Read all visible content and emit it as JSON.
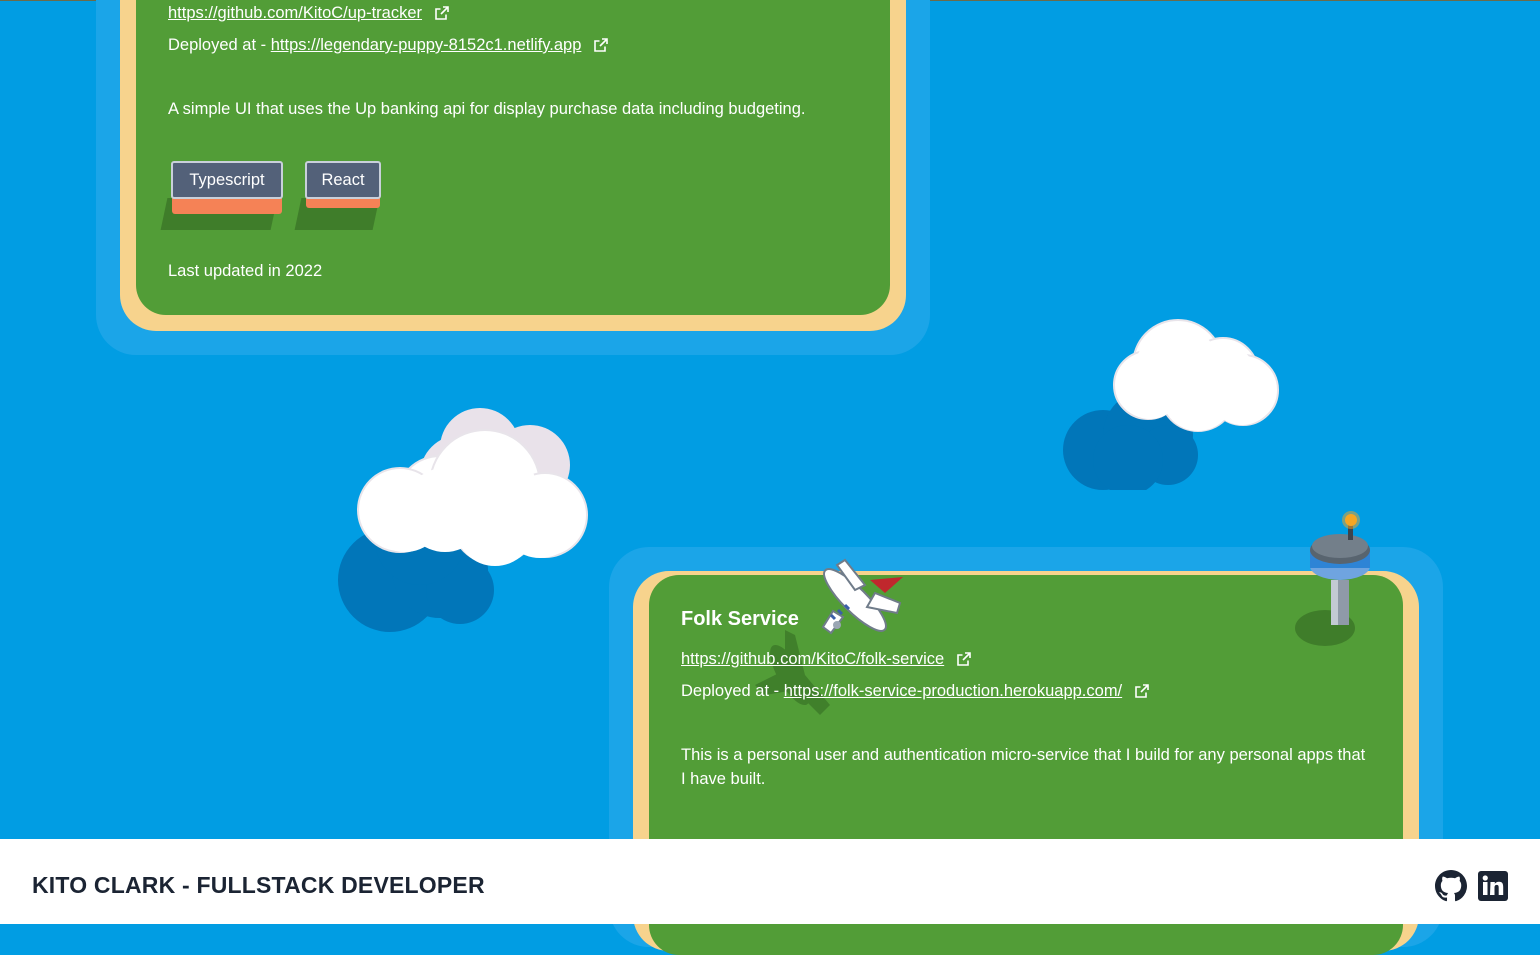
{
  "projects": [
    {
      "repo_url": "https://github.com/KitoC/up-tracker",
      "deployed_prefix": "Deployed at -",
      "deployed_url": "https://legendary-puppy-8152c1.netlify.app",
      "description": "A simple UI that uses the Up banking api for display purchase data including budgeting.",
      "tags": [
        "Typescript",
        "React"
      ],
      "updated": "Last updated in 2022"
    },
    {
      "title": "Folk Service",
      "repo_url": "https://github.com/KitoC/folk-service",
      "deployed_prefix": "Deployed at -",
      "deployed_url": "https://folk-service-production.herokuapp.com/",
      "description": "This is a personal user and authentication micro-service that I build for any personal apps that I have built."
    }
  ],
  "footer": {
    "title": "KITO CLARK - FULLSTACK DEVELOPER",
    "icons": [
      "github-icon",
      "linkedin-icon"
    ]
  },
  "colors": {
    "ocean": "#019de3",
    "grass": "#529d37",
    "sand": "#f7d38d",
    "tag": "#536179",
    "tag_base": "#f58256"
  }
}
